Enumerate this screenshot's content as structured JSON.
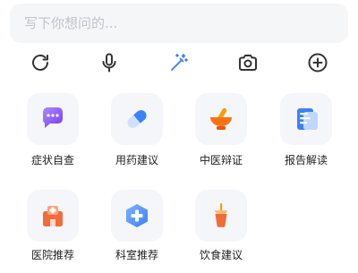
{
  "search": {
    "placeholder": "写下你想问的..."
  },
  "toolbar": {
    "items": [
      {
        "icon": "refresh-icon"
      },
      {
        "icon": "microphone-icon"
      },
      {
        "icon": "magic-wand-icon",
        "color": "#3a7cf7"
      },
      {
        "icon": "camera-icon"
      },
      {
        "icon": "add-circle-icon"
      }
    ]
  },
  "features": [
    {
      "label": "症状自查",
      "icon": "chat-bubble-icon",
      "color": "#8b5cf6"
    },
    {
      "label": "用药建议",
      "icon": "pill-icon",
      "color": "#3b82f6"
    },
    {
      "label": "中医辩证",
      "icon": "mortar-pestle-icon",
      "color": "#f97316"
    },
    {
      "label": "报告解读",
      "icon": "report-document-icon",
      "color": "#3b82f6"
    },
    {
      "label": "医院推荐",
      "icon": "hospital-icon",
      "color": "#f26b3a"
    },
    {
      "label": "科室推荐",
      "icon": "medical-cross-icon",
      "color": "#4c8df6"
    },
    {
      "label": "饮食建议",
      "icon": "cup-icon",
      "color": "#f27a3a"
    }
  ]
}
